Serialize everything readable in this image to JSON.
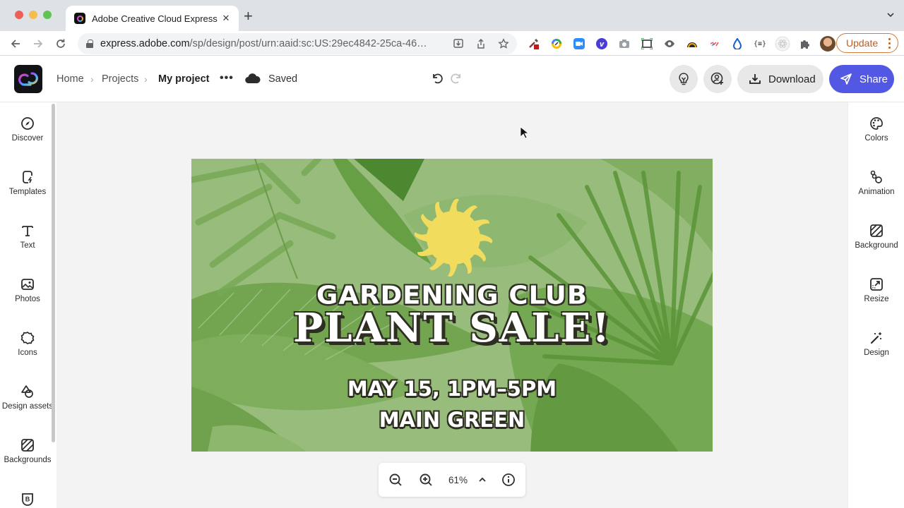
{
  "browser": {
    "tab_title": "Adobe Creative Cloud Express",
    "tab_close": "✕",
    "new_tab": "+",
    "url_host": "express.adobe.com",
    "url_path": "/sp/design/post/urn:aaid:sc:US:29ec4842-25ca-46…",
    "update_label": "Update",
    "extensions": [
      "eyedropper-icon",
      "pencil-extension-icon",
      "zoom-video-icon",
      "vimeo-icon",
      "camera-icon",
      "screenshot-frame-icon",
      "eye-icon",
      "rainbow-extension-icon",
      "color-extension-icon",
      "droplet-icon",
      "json-formatter-icon",
      "react-devtools-icon",
      "puzzle-extensions-icon",
      "profile-avatar"
    ]
  },
  "app": {
    "breadcrumb": [
      "Home",
      "Projects",
      "My project"
    ],
    "more": "•••",
    "save_status": "Saved",
    "download_label": "Download",
    "share_label": "Share",
    "brand_color": "#5258e4"
  },
  "left_rail": [
    {
      "label": "Discover",
      "icon": "compass-icon"
    },
    {
      "label": "Templates",
      "icon": "templates-icon"
    },
    {
      "label": "Text",
      "icon": "text-icon"
    },
    {
      "label": "Photos",
      "icon": "photo-icon"
    },
    {
      "label": "Icons",
      "icon": "icons-icon"
    },
    {
      "label": "Design assets",
      "icon": "design-assets-icon"
    },
    {
      "label": "Backgrounds",
      "icon": "backgrounds-icon"
    },
    {
      "label": "",
      "icon": "brand-icon"
    }
  ],
  "right_rail": [
    {
      "label": "Colors",
      "icon": "palette-icon"
    },
    {
      "label": "Animation",
      "icon": "animation-icon"
    },
    {
      "label": "Background",
      "icon": "background-icon"
    },
    {
      "label": "Resize",
      "icon": "resize-icon"
    },
    {
      "label": "Design",
      "icon": "magic-wand-icon"
    }
  ],
  "design": {
    "line1": "GARDENING CLUB",
    "line2": "PLANT SALE!",
    "line3": "MAY 15, 1PM–5PM",
    "line4": "MAIN GREEN",
    "bg_color": "#97bb7a",
    "sun_color": "#f2dc5d"
  },
  "zoom": {
    "value": "61%"
  }
}
